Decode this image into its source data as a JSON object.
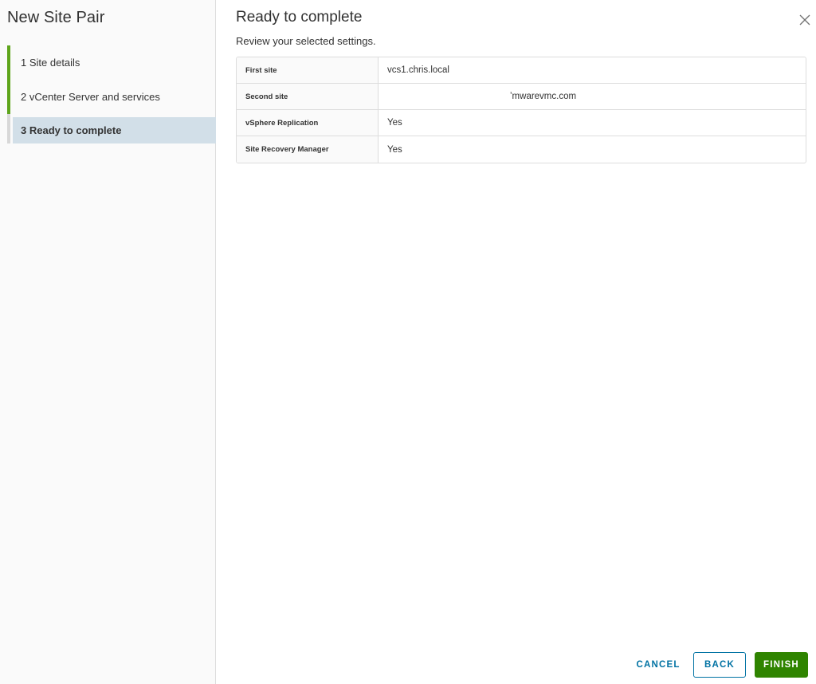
{
  "wizard": {
    "title": "New Site Pair"
  },
  "steps": [
    {
      "label": "1  Site details",
      "state": "done"
    },
    {
      "label": "2  vCenter Server and services",
      "state": "done"
    },
    {
      "label": "3  Ready to complete",
      "state": "current"
    }
  ],
  "page": {
    "title": "Ready to complete",
    "subtitle": "Review your selected settings."
  },
  "summary": [
    {
      "key": "First site",
      "value": "vcs1.chris.local"
    },
    {
      "key": "Second site",
      "value": "ʼmwarevmc.com"
    },
    {
      "key": "vSphere Replication",
      "value": "Yes"
    },
    {
      "key": "Site Recovery Manager",
      "value": "Yes"
    }
  ],
  "footer": {
    "cancel_label": "CANCEL",
    "back_label": "BACK",
    "finish_label": "FINISH"
  },
  "colors": {
    "accent_green": "#5ea51b",
    "primary_button": "#2f8400",
    "link_blue": "#0072a3",
    "selected_step_bg": "#d2dfe8"
  },
  "icons": {
    "close": "close-icon"
  }
}
